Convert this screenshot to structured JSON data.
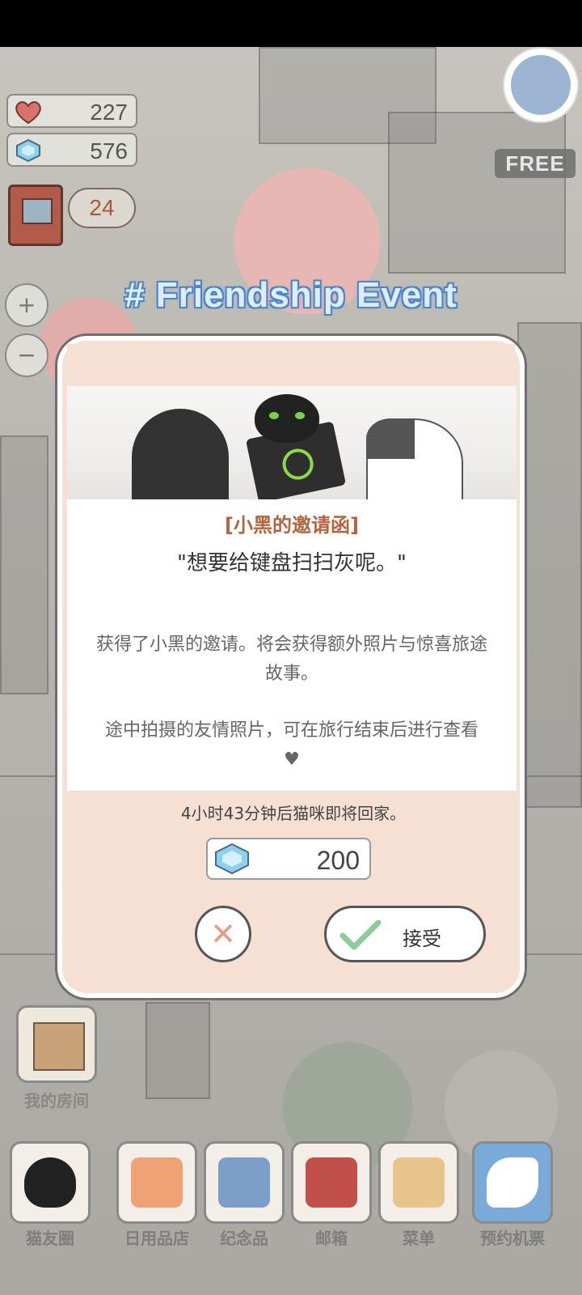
{
  "hud": {
    "hearts": "227",
    "gems": "576",
    "notification_count": "24",
    "free_badge": "FREE"
  },
  "zoom": {
    "in": "+",
    "out": "−"
  },
  "event": {
    "title": "# Friendship Event"
  },
  "modal": {
    "letter_title": "[小黑的邀请函]",
    "quote": "\"想要给键盘扫扫灰呢。\"",
    "description_1": "获得了小黑的邀请。将会获得额外照片与惊喜旅途故事。",
    "description_2": "途中拍摄的友情照片，可在旅行结束后进行查看",
    "heart_mark": "♥",
    "return_time": "4小时43分钟后猫咪即将回家。",
    "cost": "200",
    "decline_symbol": "✕",
    "accept_label": "接受"
  },
  "my_room": {
    "label": "我的房间"
  },
  "nav": {
    "cat_friends": "猫友圈",
    "daily_shop": "日用品店",
    "souvenir": "纪念品",
    "mailbox": "邮箱",
    "menu": "菜单",
    "flight_ticket": "预约机票"
  },
  "colors": {
    "modal_bg": "#f6dfd3",
    "title_accent": "#b4643c",
    "event_title": "#dbeeff",
    "gem": "#8fd0f0",
    "heart": "#d9736a"
  },
  "icons": [
    "heart-icon",
    "gem-icon",
    "book-icon",
    "zoom-in-icon",
    "zoom-out-icon",
    "close-icon",
    "check-icon",
    "avatar-icon"
  ]
}
